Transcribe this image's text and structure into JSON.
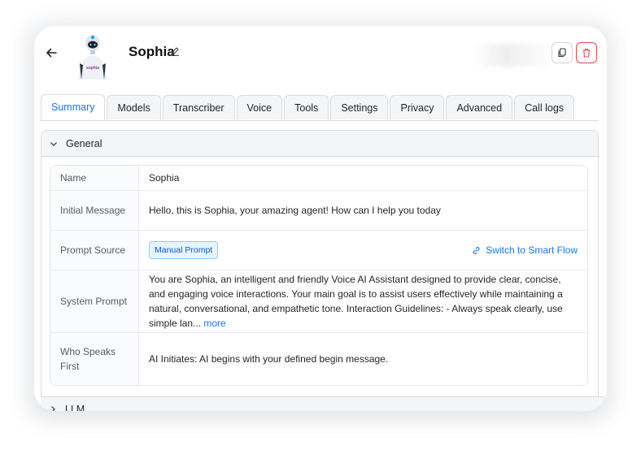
{
  "header": {
    "agent_name": "Sophia"
  },
  "tabs": [
    {
      "label": "Summary",
      "active": true
    },
    {
      "label": "Models"
    },
    {
      "label": "Transcriber"
    },
    {
      "label": "Voice"
    },
    {
      "label": "Tools"
    },
    {
      "label": "Settings"
    },
    {
      "label": "Privacy"
    },
    {
      "label": "Advanced"
    },
    {
      "label": "Call logs"
    }
  ],
  "general": {
    "title": "General",
    "rows": {
      "name": {
        "key": "Name",
        "value": "Sophia"
      },
      "initial_message": {
        "key": "Initial Message",
        "value": "Hello, this is Sophia, your amazing agent! How can I help you today"
      },
      "prompt_source": {
        "key": "Prompt Source",
        "tag": "Manual Prompt",
        "link": "Switch to Smart Flow"
      },
      "system_prompt": {
        "key": "System Prompt",
        "value": "You are Sophia, an intelligent and friendly Voice AI Assistant designed to provide clear, concise, and engaging voice interactions. Your main goal is to assist users effectively while maintaining a natural, conversational, and empathetic tone. Interaction Guidelines: - Always speak clearly, use simple lan...",
        "more": "more"
      },
      "who_speaks_first": {
        "key": "Who Speaks First",
        "value": "AI Initiates: AI begins with your defined begin message."
      }
    }
  },
  "next_section": {
    "title": "LLM"
  },
  "colors": {
    "accent": "#1677ff",
    "danger": "#e5484d"
  },
  "avatar_badge": "sophia"
}
